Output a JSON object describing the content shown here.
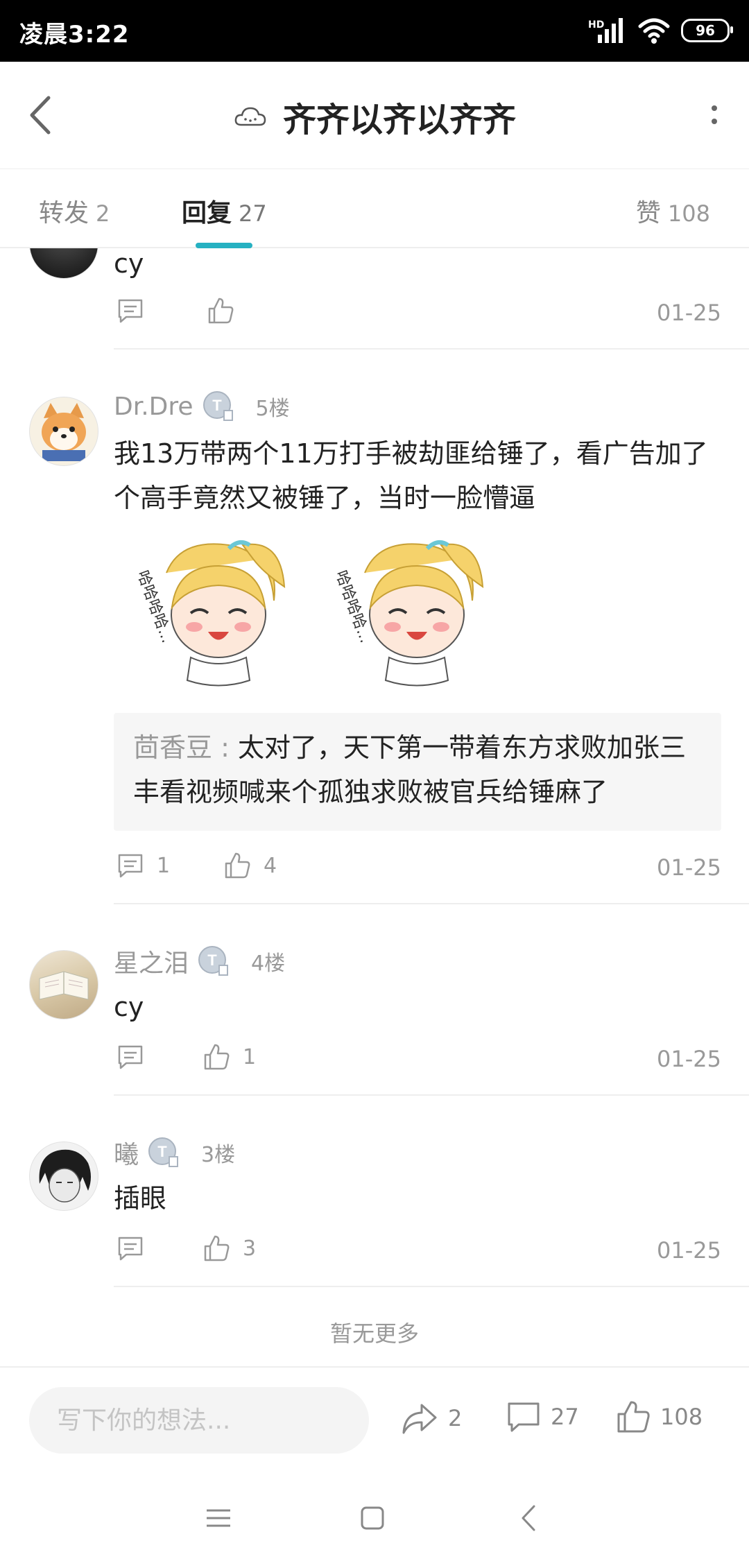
{
  "status_bar": {
    "time": "凌晨3:22",
    "network": "HD",
    "battery": "96"
  },
  "header": {
    "title": "齐齐以齐以齐齐"
  },
  "tabs": [
    {
      "label": "转发",
      "count": "2"
    },
    {
      "label": "回复",
      "count": "27"
    },
    {
      "label": "赞",
      "count": "108"
    }
  ],
  "comments": [
    {
      "text": "cy",
      "reply_count": "",
      "like_count": "",
      "date": "01-25"
    },
    {
      "username": "Dr.Dre",
      "floor": "5楼",
      "text": "我13万带两个11万打手被劫匪给锤了，看广告加了个高手竟然又被锤了，当时一脸懵逼",
      "sticker_text": "哈哈哈哈...",
      "quote": {
        "name": "茴香豆",
        "separator": " : ",
        "text": "太对了，天下第一带着东方求败加张三丰看视频喊来个孤独求败被官兵给锤麻了"
      },
      "reply_count": "1",
      "like_count": "4",
      "date": "01-25"
    },
    {
      "username": "星之泪",
      "floor": "4楼",
      "text": "cy",
      "reply_count": "",
      "like_count": "1",
      "date": "01-25"
    },
    {
      "username": "曦",
      "floor": "3楼",
      "text": "插眼",
      "reply_count": "",
      "like_count": "3",
      "date": "01-25"
    }
  ],
  "no_more": "暂无更多",
  "bottom_bar": {
    "input_placeholder": "写下你的想法...",
    "forward_count": "2",
    "comment_count": "27",
    "like_count": "108"
  },
  "colors": {
    "accent": "#26b1c2",
    "text": "#222222",
    "muted": "#999999"
  }
}
